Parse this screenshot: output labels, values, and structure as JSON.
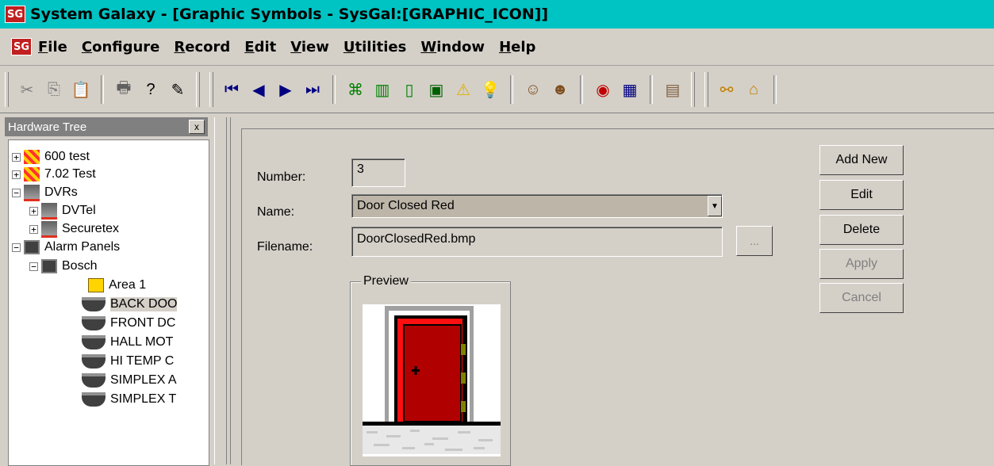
{
  "app": {
    "title": "System Galaxy - [Graphic Symbols - SysGal:[GRAPHIC_ICON]]",
    "logo_text": "SG"
  },
  "menu": {
    "items": [
      {
        "label": "File",
        "mnemonic": "F",
        "rest": "ile"
      },
      {
        "label": "Configure",
        "mnemonic": "C",
        "rest": "onfigure"
      },
      {
        "label": "Record",
        "mnemonic": "R",
        "rest": "ecord"
      },
      {
        "label": "Edit",
        "mnemonic": "E",
        "rest": "dit"
      },
      {
        "label": "View",
        "mnemonic": "V",
        "rest": "iew"
      },
      {
        "label": "Utilities",
        "mnemonic": "U",
        "rest": "tilities"
      },
      {
        "label": "Window",
        "mnemonic": "W",
        "rest": "indow"
      },
      {
        "label": "Help",
        "mnemonic": "H",
        "rest": "elp"
      }
    ]
  },
  "toolbar": {
    "icons": [
      {
        "name": "cut-icon",
        "glyph": "✂"
      },
      {
        "name": "copy-icon",
        "glyph": "⎘"
      },
      {
        "name": "paste-icon",
        "glyph": "📋"
      },
      {
        "name": "print-icon",
        "glyph": "🖶"
      },
      {
        "name": "help-icon",
        "glyph": "?"
      },
      {
        "name": "edit-doc-icon",
        "glyph": "✎"
      },
      {
        "name": "first-record-icon",
        "glyph": "⏮"
      },
      {
        "name": "prev-record-icon",
        "glyph": "◀"
      },
      {
        "name": "next-record-icon",
        "glyph": "▶"
      },
      {
        "name": "last-record-icon",
        "glyph": "⏭"
      },
      {
        "name": "network-icon",
        "glyph": "⌘"
      },
      {
        "name": "door-group-icon",
        "glyph": "▥"
      },
      {
        "name": "door-icon",
        "glyph": "▯"
      },
      {
        "name": "panel-icon",
        "glyph": "▣"
      },
      {
        "name": "warning-icon",
        "glyph": "⚠"
      },
      {
        "name": "light-icon",
        "glyph": "💡"
      },
      {
        "name": "cardholder-icon",
        "glyph": "☺"
      },
      {
        "name": "operators-icon",
        "glyph": "☻"
      },
      {
        "name": "schedule-icon",
        "glyph": "◉"
      },
      {
        "name": "grid-icon",
        "glyph": "▦"
      },
      {
        "name": "map-icon",
        "glyph": "▤"
      },
      {
        "name": "link-icon",
        "glyph": "⚯"
      },
      {
        "name": "building-icon",
        "glyph": "⌂"
      }
    ]
  },
  "tree": {
    "title": "Hardware Tree",
    "close": "x",
    "nodes": [
      {
        "label": "600 test",
        "exp": "+"
      },
      {
        "label": "7.02 Test",
        "exp": "+"
      },
      {
        "label": "DVRs",
        "exp": "−"
      },
      {
        "label": "DVTel",
        "exp": "+"
      },
      {
        "label": "Securetex",
        "exp": "+"
      },
      {
        "label": "Alarm Panels",
        "exp": "−"
      },
      {
        "label": "Bosch",
        "exp": "−"
      },
      {
        "label": "Area 1",
        "exp": ""
      },
      {
        "label": "BACK DOO",
        "exp": ""
      },
      {
        "label": "FRONT DC",
        "exp": ""
      },
      {
        "label": "HALL MOT",
        "exp": ""
      },
      {
        "label": "HI TEMP C",
        "exp": ""
      },
      {
        "label": "SIMPLEX A",
        "exp": ""
      },
      {
        "label": "SIMPLEX T",
        "exp": ""
      }
    ]
  },
  "form": {
    "number_label": "Number:",
    "number_value": "3",
    "name_label": "Name:",
    "name_value": "Door Closed Red",
    "filename_label": "Filename:",
    "filename_value": "DoorClosedRed.bmp",
    "browse_label": "...",
    "preview_label": "Preview"
  },
  "buttons": {
    "add_new": "Add New",
    "edit": "Edit",
    "delete": "Delete",
    "apply": "Apply",
    "cancel": "Cancel"
  },
  "colors": {
    "title_bar": "#00c3c3",
    "door_red": "#c00000",
    "door_frame": "#ff2020"
  }
}
